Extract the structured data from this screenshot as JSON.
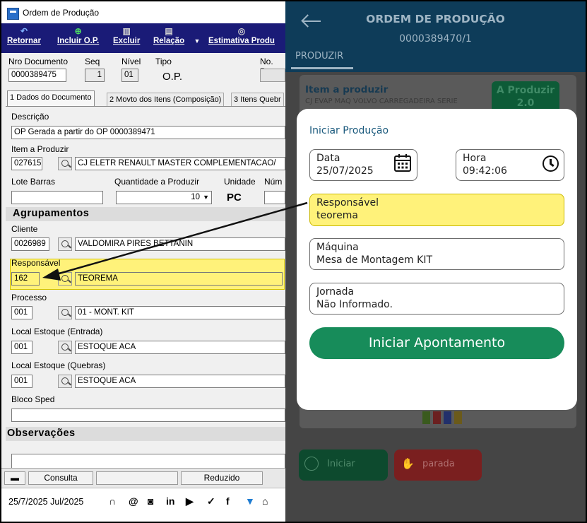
{
  "desktop": {
    "window_title": "Ordem de Produção",
    "toolbar": {
      "retornar": "Retornar",
      "incluir": "Incluir O.P.",
      "excluir": "Excluir",
      "relacao": "Relação",
      "estimativa": "Estimativa Produ"
    },
    "header": {
      "nro_documento_label": "Nro Documento",
      "nro_documento_value": "0000389475",
      "seq_label": "Seq",
      "seq_value": "1",
      "nivel_label": "Nível",
      "nivel_value": "01",
      "tipo_label": "Tipo",
      "tipo_value": "O.P.",
      "no_pe_label": "No. Pe"
    },
    "tabs": [
      {
        "label": "1 Dados do Documento"
      },
      {
        "label": "2 Movto dos Itens (Composição)"
      },
      {
        "label": "3 Itens Quebr"
      }
    ],
    "form": {
      "descricao_label": "Descrição",
      "descricao_value": "OP Gerada a partir do OP 0000389471",
      "item_label": "Item a Produzir",
      "item_code": "027615",
      "item_desc": "CJ ELETR RENAULT MASTER COMPLEMENTACAO/",
      "lote_label": "Lote Barras",
      "qtd_label": "Quantidade a Produzir",
      "qtd_value": "10",
      "unidade_label": "Unidade",
      "unidade_value": "PC",
      "numero_label": "Núm",
      "agrupamentos": "Agrupamentos",
      "cliente_label": "Cliente",
      "cliente_code": "0026989",
      "cliente_name": "VALDOMIRA PIRES BETTANIN",
      "responsavel_label": "Responsável",
      "responsavel_code": "162",
      "responsavel_name": "TEOREMA",
      "processo_label": "Processo",
      "processo_code": "001",
      "processo_name": "01 - MONT. KIT",
      "local_entrada_label": "Local Estoque (Entrada)",
      "local_entrada_code": "001",
      "local_entrada_name": "ESTOQUE ACA",
      "local_quebras_label": "Local Estoque (Quebras)",
      "local_quebras_code": "001",
      "local_quebras_name": "ESTOQUE ACA",
      "bloco_sped_label": "Bloco Sped",
      "observacoes": "Observações"
    },
    "status": {
      "consulta": "Consulta",
      "reduzido": "Reduzido"
    },
    "footer": {
      "date": "25/7/2025 Jul/2025"
    }
  },
  "mobile": {
    "title": "ORDEM DE PRODUÇÃO",
    "subtitle": "0000389470/1",
    "tab": "PRODUZIR",
    "item_label": "Item a produzir",
    "item_value": "CJ EVAP MAQ VOLVO CARREGADEIRA SERIE",
    "badge_label": "A Produzir",
    "badge_value": "2.0",
    "modal": {
      "title": "Iniciar Produção",
      "data_label": "Data",
      "data_value": "25/07/2025",
      "hora_label": "Hora",
      "hora_value": "09:42:06",
      "responsavel_label": "Responsável",
      "responsavel_value": "teorema",
      "maquina_label": "Máquina",
      "maquina_value": "Mesa de Montagem KIT",
      "jornada_label": "Jornada",
      "jornada_value": "Não Informado.",
      "button": "Iniciar Apontamento"
    },
    "bottom": {
      "iniciar": "Iniciar",
      "parada": "parada"
    }
  },
  "colors": {
    "toolbar": "#1a1b77",
    "appbar": "#0e3c59",
    "highlight": "#fff27a",
    "primary_button": "#178c5a",
    "arrow": "#111111"
  }
}
